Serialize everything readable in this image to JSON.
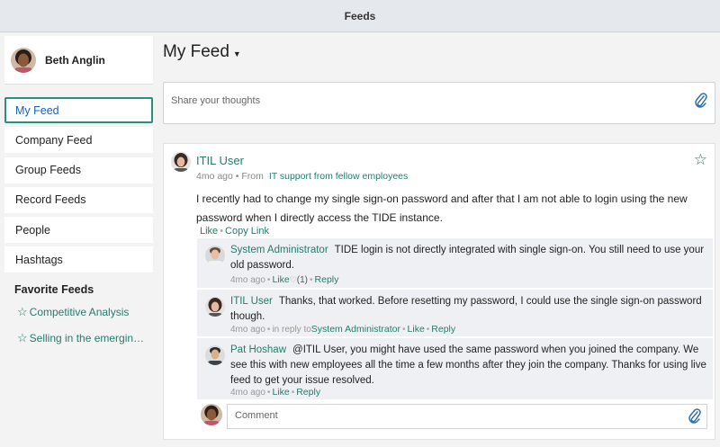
{
  "window": {
    "title": "Feeds"
  },
  "user": {
    "name": "Beth Anglin"
  },
  "nav": {
    "items": [
      {
        "label": "My Feed",
        "active": true
      },
      {
        "label": "Company Feed"
      },
      {
        "label": "Group Feeds"
      },
      {
        "label": "Record Feeds"
      },
      {
        "label": "People"
      },
      {
        "label": "Hashtags"
      }
    ],
    "favorites_title": "Favorite Feeds",
    "favorites": [
      {
        "label": "Competitive Analysis"
      },
      {
        "label": "Selling in the emergin…"
      }
    ]
  },
  "main": {
    "title": "My Feed",
    "share_placeholder": "Share your thoughts"
  },
  "post": {
    "author": "ITIL User",
    "time": "4mo ago",
    "from_label": "From",
    "from_group": "IT support from fellow employees",
    "body": "I recently had to change my single sign-on password and after that I am not able to login using the new password when I directly access the TIDE instance.",
    "like_label": "Like",
    "copy_link_label": "Copy Link",
    "replies": [
      {
        "author": "System Administrator",
        "text": "TIDE login is not directly integrated with single sign-on. You still need to use your old password.",
        "time": "4mo ago",
        "like_label": "Like",
        "like_count": "(1)",
        "reply_label": "Reply"
      },
      {
        "author": "ITIL User",
        "text": "Thanks, that worked. Before resetting my password, I could use the single sign-on password though.",
        "time": "4mo ago",
        "in_reply_label": "in reply to",
        "in_reply_to": "System Administrator",
        "like_label": "Like",
        "reply_label": "Reply"
      },
      {
        "author": "Pat Hoshaw",
        "text": "@ITIL User, you might have used the same password when you joined the company. We see this with new employees all the time a few months after they join the company. Thanks for using live feed to get your issue resolved.",
        "time": "4mo ago",
        "like_label": "Like",
        "reply_label": "Reply"
      }
    ],
    "comment_placeholder": "Comment"
  }
}
